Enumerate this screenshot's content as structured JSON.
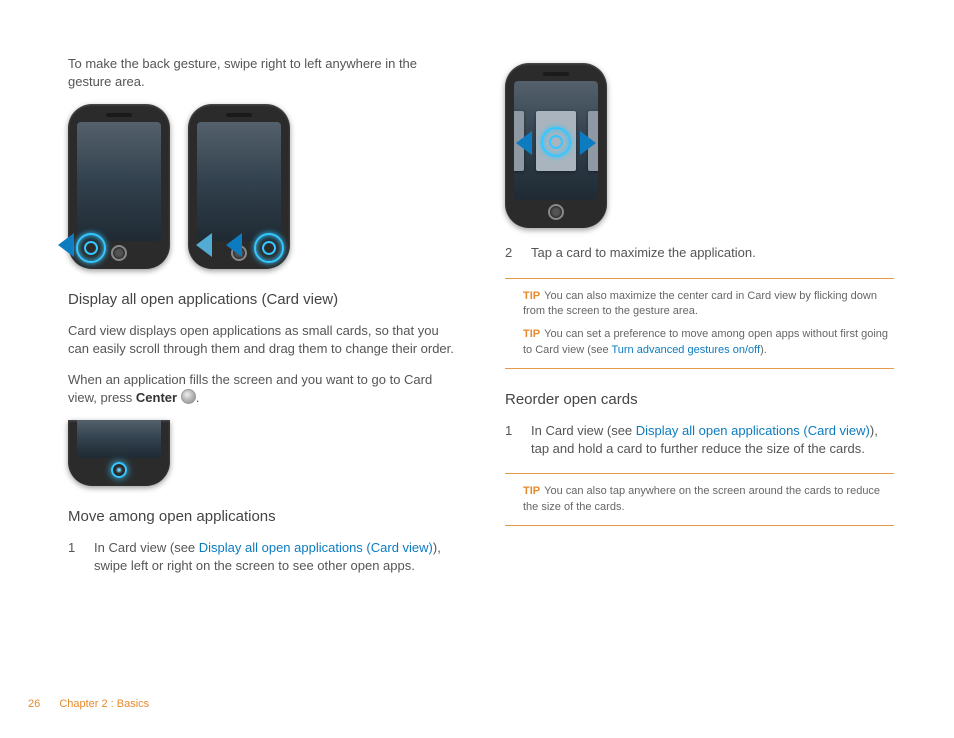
{
  "intro": "To make the back gesture, swipe right to left anywhere in the gesture area.",
  "sec1_title": "Display all open applications (Card view)",
  "sec1_p1": "Card view displays open applications as small cards, so that you can easily scroll through them and drag them to change their order.",
  "sec1_p2a": "When an application fills the screen and you want to go to Card view, press ",
  "sec1_p2b": "Center",
  "sec1_p2c": ".",
  "sec2_title": "Move among open applications",
  "step1_num": "1",
  "step1_a": "In Card view (see ",
  "step1_link": "Display all open applications (Card view)",
  "step1_b": "), swipe left or right on the screen to see other open apps.",
  "step2_num": "2",
  "step2_text": "Tap a card to maximize the application.",
  "tip_label": "TIP",
  "tip1": "You can also maximize the center card in Card view by flicking down from the screen to the gesture area.",
  "tip2a": "You can set a preference to move among open apps without first going to Card view (see ",
  "tip2_link": "Turn advanced gestures on/off",
  "tip2b": ").",
  "sec3_title": "Reorder open cards",
  "step3_num": "1",
  "step3_a": "In Card view (see ",
  "step3_link": "Display all open applications (Card view)",
  "step3_b": "), tap and hold a card to further reduce the size of the cards.",
  "tip3": "You can also tap anywhere on the screen around the cards to reduce the size of the cards.",
  "footer_page": "26",
  "footer_chap": "Chapter 2 : Basics"
}
